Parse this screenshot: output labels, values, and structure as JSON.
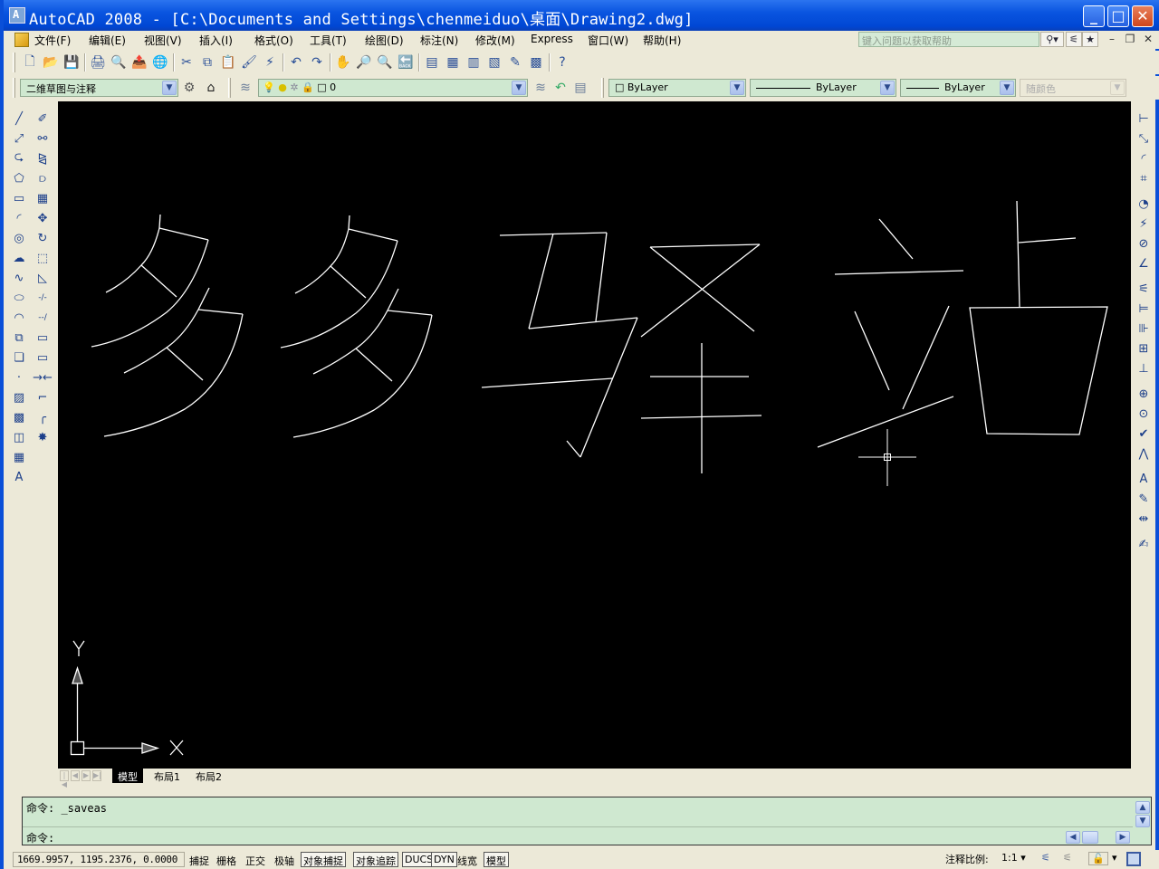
{
  "window": {
    "title": "AutoCAD 2008 - [C:\\Documents and Settings\\chenmeiduo\\桌面\\Drawing2.dwg]",
    "controls": {
      "minimize": "_",
      "maximize": "□",
      "close": "✕"
    }
  },
  "menubar": {
    "items": [
      "文件(F)",
      "编辑(E)",
      "视图(V)",
      "插入(I)",
      "格式(O)",
      "工具(T)",
      "绘图(D)",
      "标注(N)",
      "修改(M)",
      "Express",
      "窗口(W)",
      "帮助(H)"
    ],
    "help_search_placeholder": "键入问题以获取帮助"
  },
  "standard_toolbar": {
    "buttons": [
      {
        "name": "new-icon",
        "glyph": "🗋"
      },
      {
        "name": "open-icon",
        "glyph": "📂"
      },
      {
        "name": "save-icon",
        "glyph": "💾"
      },
      {
        "name": "plot-icon",
        "glyph": "🖨"
      },
      {
        "name": "plot-preview-icon",
        "glyph": "🔍"
      },
      {
        "name": "publish-icon",
        "glyph": "📤"
      },
      {
        "name": "3d-dwf-icon",
        "glyph": "🌐"
      },
      {
        "name": "cut-icon",
        "glyph": "✂"
      },
      {
        "name": "copy-icon",
        "glyph": "⧉"
      },
      {
        "name": "paste-icon",
        "glyph": "📋"
      },
      {
        "name": "match-properties-icon",
        "glyph": "🖌"
      },
      {
        "name": "block-editor-icon",
        "glyph": "⚡"
      },
      {
        "name": "undo-icon",
        "glyph": "↶"
      },
      {
        "name": "redo-icon",
        "glyph": "↷"
      },
      {
        "name": "pan-icon",
        "glyph": "✋"
      },
      {
        "name": "zoom-realtime-icon",
        "glyph": "🔎"
      },
      {
        "name": "zoom-window-icon",
        "glyph": "🔍"
      },
      {
        "name": "zoom-previous-icon",
        "glyph": "🔙"
      },
      {
        "name": "properties-icon",
        "glyph": "▤"
      },
      {
        "name": "design-center-icon",
        "glyph": "▦"
      },
      {
        "name": "tool-palettes-icon",
        "glyph": "▥"
      },
      {
        "name": "sheet-set-icon",
        "glyph": "▧"
      },
      {
        "name": "markup-icon",
        "glyph": "✎"
      },
      {
        "name": "calculator-icon",
        "glyph": "▩"
      },
      {
        "name": "help-icon",
        "glyph": "?"
      }
    ]
  },
  "workspace": {
    "current": "二维草图与注释"
  },
  "layers": {
    "current_layer": "0"
  },
  "properties": {
    "color": "ByLayer",
    "linetype": "ByLayer",
    "lineweight": "ByLayer",
    "plotstyle": "随颜色"
  },
  "draw_toolbar": {
    "tools": [
      {
        "name": "line-icon",
        "glyph": "╱"
      },
      {
        "name": "construction-line-icon",
        "glyph": "⤢"
      },
      {
        "name": "polyline-icon",
        "glyph": "⮎"
      },
      {
        "name": "polygon-icon",
        "glyph": "⬠"
      },
      {
        "name": "rectangle-icon",
        "glyph": "▭"
      },
      {
        "name": "arc-icon",
        "glyph": "◜"
      },
      {
        "name": "circle-icon",
        "glyph": "◎"
      },
      {
        "name": "revision-cloud-icon",
        "glyph": "☁"
      },
      {
        "name": "spline-icon",
        "glyph": "∿"
      },
      {
        "name": "ellipse-icon",
        "glyph": "⬭"
      },
      {
        "name": "ellipse-arc-icon",
        "glyph": "◠"
      },
      {
        "name": "insert-block-icon",
        "glyph": "⧉"
      },
      {
        "name": "make-block-icon",
        "glyph": "❏"
      },
      {
        "name": "point-icon",
        "glyph": "·"
      },
      {
        "name": "hatch-icon",
        "glyph": "▨"
      },
      {
        "name": "gradient-icon",
        "glyph": "▩"
      },
      {
        "name": "region-icon",
        "glyph": "◫"
      },
      {
        "name": "table-icon",
        "glyph": "▦"
      },
      {
        "name": "multiline-text-icon",
        "glyph": "A"
      }
    ]
  },
  "modify_toolbar": {
    "tools": [
      {
        "name": "erase-icon",
        "glyph": "✐"
      },
      {
        "name": "copy-object-icon",
        "glyph": "⚯"
      },
      {
        "name": "mirror-icon",
        "glyph": "⧎"
      },
      {
        "name": "offset-icon",
        "glyph": "⫐"
      },
      {
        "name": "array-icon",
        "glyph": "▦"
      },
      {
        "name": "move-icon",
        "glyph": "✥"
      },
      {
        "name": "rotate-icon",
        "glyph": "↻"
      },
      {
        "name": "scale-icon",
        "glyph": "⬚"
      },
      {
        "name": "stretch-icon",
        "glyph": "◺"
      },
      {
        "name": "trim-icon",
        "glyph": "-/-"
      },
      {
        "name": "extend-icon",
        "glyph": "--/"
      },
      {
        "name": "break-at-point-icon",
        "glyph": "▭"
      },
      {
        "name": "break-icon",
        "glyph": "▭"
      },
      {
        "name": "join-icon",
        "glyph": "→←"
      },
      {
        "name": "chamfer-icon",
        "glyph": "⌐"
      },
      {
        "name": "fillet-icon",
        "glyph": "╭"
      },
      {
        "name": "explode-icon",
        "glyph": "✸"
      }
    ]
  },
  "dimension_toolbar": {
    "tools": [
      {
        "name": "linear-dimension-icon",
        "glyph": "⊢"
      },
      {
        "name": "aligned-dimension-icon",
        "glyph": "⤡"
      },
      {
        "name": "arc-length-icon",
        "glyph": "◜"
      },
      {
        "name": "ordinate-icon",
        "glyph": "⌗"
      },
      {
        "name": "radius-icon",
        "glyph": "◔"
      },
      {
        "name": "jogged-icon",
        "glyph": "⚡"
      },
      {
        "name": "diameter-icon",
        "glyph": "⊘"
      },
      {
        "name": "angular-icon",
        "glyph": "∠"
      },
      {
        "name": "quick-dimension-icon",
        "glyph": "⚟"
      },
      {
        "name": "baseline-icon",
        "glyph": "⊨"
      },
      {
        "name": "continue-icon",
        "glyph": "⊪"
      },
      {
        "name": "dimension-space-icon",
        "glyph": "⊞"
      },
      {
        "name": "dimension-break-icon",
        "glyph": "⊥"
      },
      {
        "name": "tolerance-icon",
        "glyph": "⊕"
      },
      {
        "name": "center-mark-icon",
        "glyph": "⊙"
      },
      {
        "name": "inspection-icon",
        "glyph": "✔"
      },
      {
        "name": "jogged-linear-icon",
        "glyph": "⋀"
      },
      {
        "name": "dimension-edit-icon",
        "glyph": "A"
      },
      {
        "name": "dimension-text-edit-icon",
        "glyph": "✎"
      },
      {
        "name": "dimension-update-icon",
        "glyph": "⇹"
      },
      {
        "name": "dimension-style-icon",
        "glyph": "✍"
      }
    ]
  },
  "drawing": {
    "description": "Hand-drawn line-art of the characters 多驿站 in model space",
    "ucs": {
      "x_label": "X",
      "y_label": "Y"
    }
  },
  "layout_tabs": [
    "模型",
    "布局1",
    "布局2"
  ],
  "active_tab": "模型",
  "command_line": {
    "history": "命令:  _saveas",
    "prompt": "命令:"
  },
  "status": {
    "coordinates": "1669.9957, 1195.2376, 0.0000",
    "toggles": [
      {
        "label": "捕捉",
        "on": false
      },
      {
        "label": "栅格",
        "on": false
      },
      {
        "label": "正交",
        "on": false
      },
      {
        "label": "极轴",
        "on": false
      },
      {
        "label": "对象捕捉",
        "on": true
      },
      {
        "label": "对象追踪",
        "on": true
      },
      {
        "label": "DUCS",
        "on": true
      },
      {
        "label": "DYN",
        "on": true
      },
      {
        "label": "线宽",
        "on": false
      },
      {
        "label": "模型",
        "on": true
      }
    ],
    "annotation_scale_label": "注释比例:",
    "annotation_scale_value": "1:1"
  }
}
